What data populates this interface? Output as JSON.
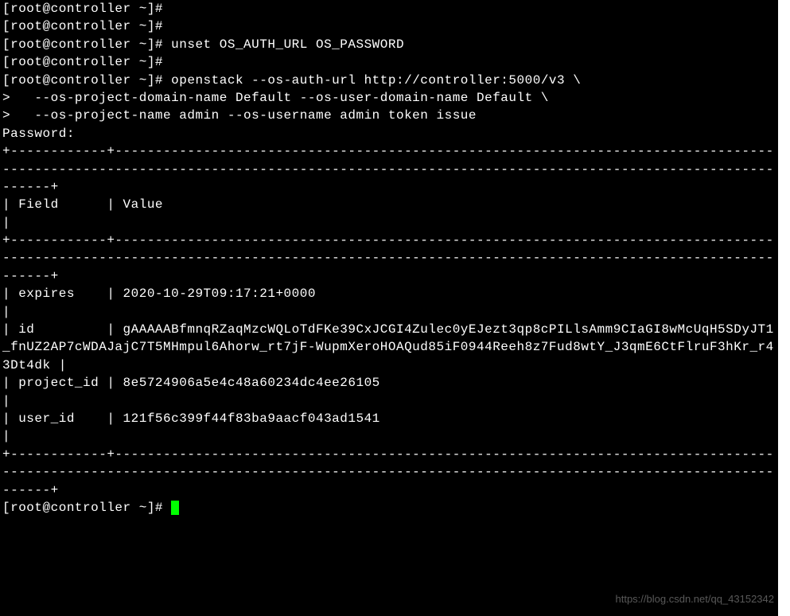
{
  "prompt": "[root@controller ~]#",
  "commands": {
    "blank1": "",
    "blank2": "",
    "unset": "unset OS_AUTH_URL OS_PASSWORD",
    "blank3": "",
    "openstack_l1": "openstack --os-auth-url http://controller:5000/v3 \\",
    "openstack_l2": ">   --os-project-domain-name Default --os-user-domain-name Default \\",
    "openstack_l3": ">   --os-project-name admin --os-username admin token issue"
  },
  "password_prompt": "Password:",
  "table": {
    "sep_top": "+------------+----------------------------------------------------------------------------------------------------------------------------------------------------------------------------------------+",
    "header": "| Field      | Value                                                                                                                                                                                   |",
    "sep_mid": "+------------+----------------------------------------------------------------------------------------------------------------------------------------------------------------------------------------+",
    "row_expires": "| expires    | 2020-10-29T09:17:21+0000                                                                                                                                                                |",
    "row_id": "| id         | gAAAAABfmnqRZaqMzcWQLoTdFKe39CxJCGI4Zulec0yEJezt3qp8cPILlsAmm9CIaGI8wMcUqH5SDyJT1_fnUZ2AP7cWDAJajC7T5MHmpul6Ahorw_rt7jF-WupmXeroHOAQud85iF0944Reeh8z7Fud8wtY_J3qmE6CtFlruF3hKr_r43Dt4dk |",
    "row_project": "| project_id | 8e5724906a5e4c48a60234dc4ee26105                                                                                                                                                         |",
    "row_user": "| user_id    | 121f56c399f44f83ba9aacf043ad1541                                                                                                                                                         |",
    "sep_bot": "+------------+----------------------------------------------------------------------------------------------------------------------------------------------------------------------------------------+"
  },
  "final_prompt": "[root@controller ~]# ",
  "watermark": "https://blog.csdn.net/qq_43152342"
}
